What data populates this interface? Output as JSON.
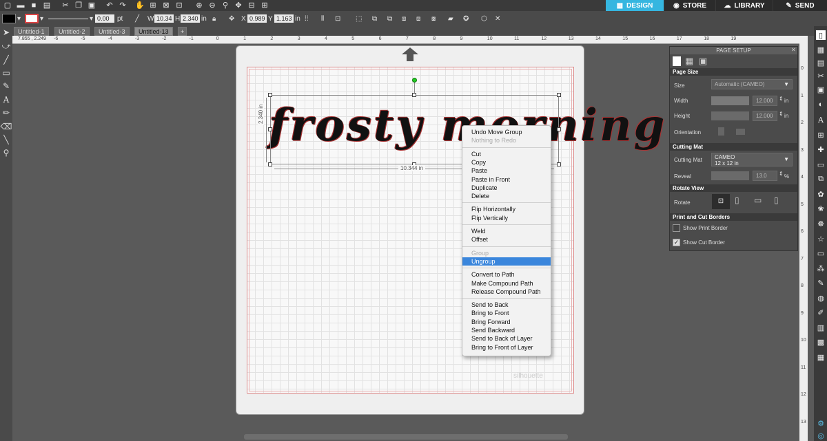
{
  "nav": {
    "design": "DESIGN",
    "store": "STORE",
    "library": "LIBRARY",
    "send": "SEND",
    "active_color": "#35b6e0"
  },
  "toolbar": {
    "line_width": "0.00",
    "line_unit": "pt",
    "w_label": "W",
    "w_value": "10.34",
    "h_label": "H",
    "h_value": "2.340",
    "unit": "in",
    "x_label": "X",
    "x_value": "0.989",
    "y_label": "Y",
    "y_value": "1.163"
  },
  "tabs": [
    "Untitled-1",
    "Untitled-2",
    "Untitled-3",
    "Untitled-13"
  ],
  "active_tab": "Untitled-13",
  "ruler": {
    "coords": "7.855 , 2.249",
    "top_ticks": [
      "-6",
      "-5",
      "-4",
      "-3",
      "-2",
      "-1",
      "0",
      "1",
      "2",
      "3",
      "4",
      "5",
      "6",
      "7",
      "8",
      "9",
      "10",
      "11",
      "12",
      "13",
      "14",
      "15",
      "16",
      "17",
      "18",
      "19"
    ],
    "right_ticks": [
      "0",
      "1",
      "2",
      "3",
      "4",
      "5",
      "6",
      "7",
      "8",
      "9",
      "10",
      "11",
      "12",
      "13"
    ]
  },
  "canvas": {
    "artwork_text": "frosty morning",
    "width_label": "10.344 in",
    "height_label": "2.340 in",
    "watermark": "silhouette"
  },
  "context_menu": {
    "groups": [
      [
        "Undo Move Group",
        "Nothing to Redo"
      ],
      [
        "Cut",
        "Copy",
        "Paste",
        "Paste in Front",
        "Duplicate",
        "Delete"
      ],
      [
        "Flip Horizontally",
        "Flip Vertically"
      ],
      [
        "Weld",
        "Offset"
      ],
      [
        "Group",
        "Ungroup"
      ],
      [
        "Convert to Path",
        "Make Compound Path",
        "Release Compound Path"
      ],
      [
        "Send to Back",
        "Bring to Front",
        "Bring Forward",
        "Send Backward",
        "Send to Back of Layer",
        "Bring to Front of Layer"
      ]
    ],
    "disabled": [
      "Nothing to Redo",
      "Group"
    ],
    "highlighted": "Ungroup"
  },
  "panel": {
    "title": "PAGE SETUP",
    "page_size_header": "Page Size",
    "size_label": "Size",
    "size_value": "Automatic (CAMEO)",
    "width_label": "Width",
    "width_value": "12.000",
    "height_label": "Height",
    "height_value": "12.000",
    "unit": "in",
    "orientation_label": "Orientation",
    "cutting_mat_header": "Cutting Mat",
    "cutting_mat_label": "Cutting Mat",
    "cutting_mat_value_1": "CAMEO",
    "cutting_mat_value_2": "12 x 12 in",
    "reveal_label": "Reveal",
    "reveal_value": "13.0",
    "reveal_unit": "%",
    "rotate_view_header": "Rotate View",
    "rotate_label": "Rotate",
    "borders_header": "Print and Cut Borders",
    "show_print_border": "Show Print Border",
    "show_cut_border": "Show Cut Border",
    "show_cut_border_checked": true
  }
}
